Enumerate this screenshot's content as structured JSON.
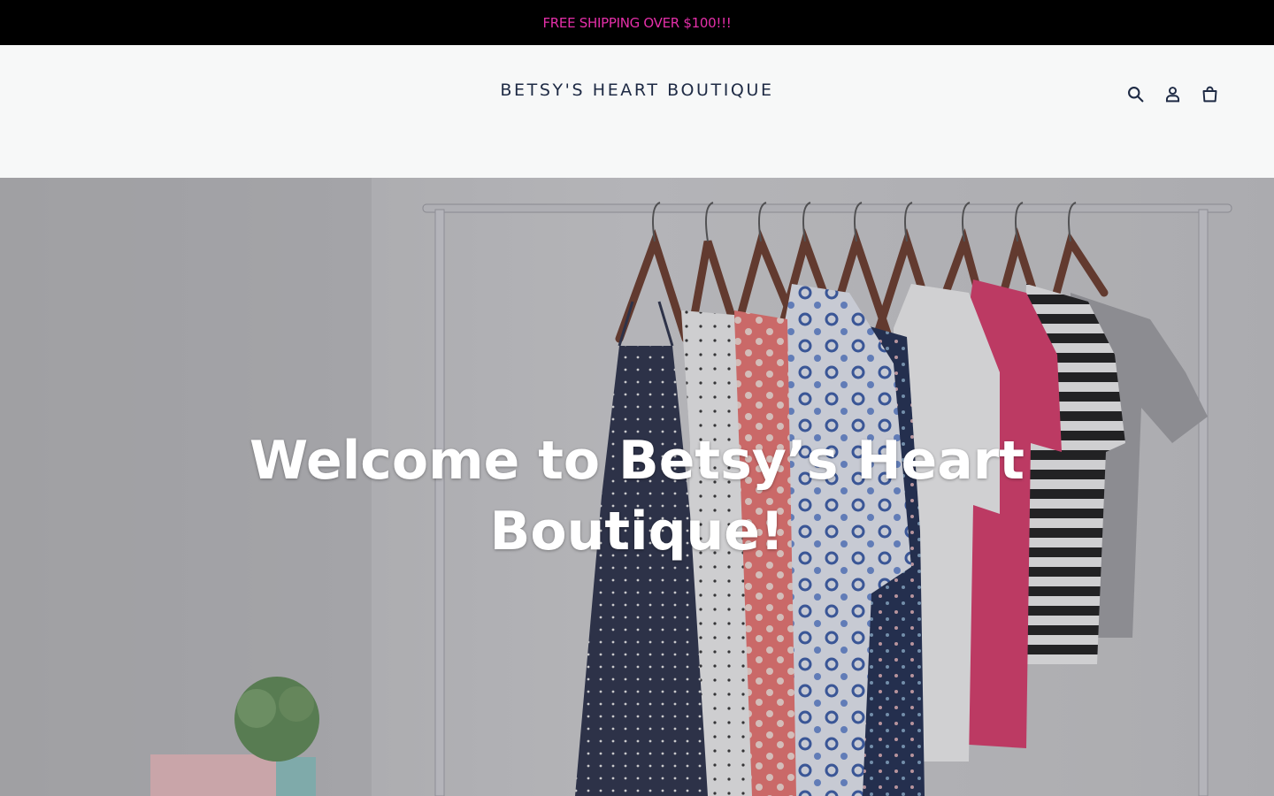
{
  "announcement": {
    "text": "FREE SHIPPING OVER $100!!!",
    "color": "#e52fa9",
    "background": "#000000"
  },
  "header": {
    "logo": "BETSY'S HEART BOUTIQUE",
    "icons": [
      "search-icon",
      "account-icon",
      "cart-icon"
    ]
  },
  "hero": {
    "title": "Welcome to Betsy’s Heart Boutique!"
  },
  "colors": {
    "logo": "#1e2a44",
    "header_bg": "#f7f8f8"
  }
}
